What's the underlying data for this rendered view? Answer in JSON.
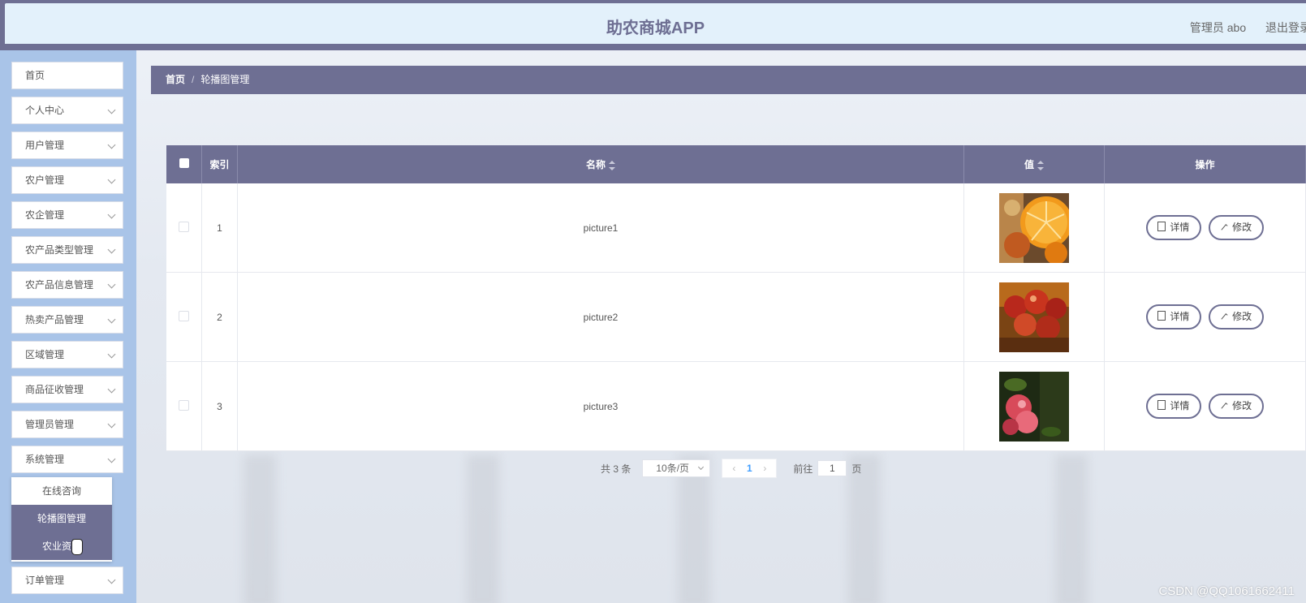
{
  "header": {
    "title": "助农商城APP",
    "user_label": "管理员 abo",
    "logout_label": "退出登录"
  },
  "sidebar": {
    "items": [
      {
        "label": "首页"
      },
      {
        "label": "个人中心"
      },
      {
        "label": "用户管理"
      },
      {
        "label": "农户管理"
      },
      {
        "label": "农企管理"
      },
      {
        "label": "农产品类型管理"
      },
      {
        "label": "农产品信息管理"
      },
      {
        "label": "热卖产品管理"
      },
      {
        "label": "区域管理"
      },
      {
        "label": "商品征收管理"
      },
      {
        "label": "管理员管理"
      },
      {
        "label": "系统管理"
      },
      {
        "label": "订单管理"
      }
    ],
    "submenu": [
      {
        "label": "在线咨询"
      },
      {
        "label": "轮播图管理"
      },
      {
        "label": "农业资讯"
      }
    ]
  },
  "breadcrumb": {
    "home": "首页",
    "separator": "/",
    "current": "轮播图管理"
  },
  "table": {
    "columns": {
      "index": "索引",
      "name": "名称",
      "value": "值",
      "actions": "操作"
    },
    "rows": [
      {
        "index": "1",
        "name": "picture1"
      },
      {
        "index": "2",
        "name": "picture2"
      },
      {
        "index": "3",
        "name": "picture3"
      }
    ],
    "detail_label": "详情",
    "edit_label": "修改"
  },
  "pagination": {
    "total": "共 3 条",
    "page_size": "10条/页",
    "current_page": "1",
    "goto_prefix": "前往",
    "goto_value": "1",
    "goto_suffix": "页"
  },
  "watermark": "CSDN @QQ1061662411"
}
